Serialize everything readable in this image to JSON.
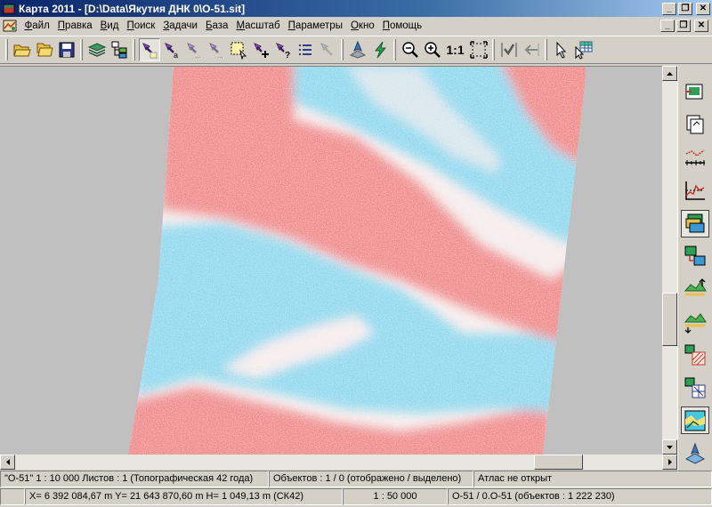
{
  "window": {
    "title": "Карта 2011 - [D:\\Data\\Якутия ДНК 0\\O-51.sit]",
    "controls": [
      "_",
      "❐",
      "✕"
    ]
  },
  "menu": {
    "items": [
      "Файл",
      "Правка",
      "Вид",
      "Поиск",
      "Задачи",
      "База",
      "Масштаб",
      "Параметры",
      "Окно",
      "Помощь"
    ],
    "underlined_letters": [
      "Ф",
      "П",
      "В",
      "П",
      "З",
      "Б",
      "М",
      "П",
      "О",
      "П"
    ]
  },
  "toolbar": {
    "scale_button_label": "1:1",
    "icons": [
      "open-folder-icon",
      "open-set-icon",
      "save-icon",
      "layers-icon",
      "object-tree-icon",
      "select-object-icon",
      "select-text-icon",
      "select-multi-icon",
      "select-area-icon",
      "select-frame-icon",
      "add-object-icon",
      "query-object-icon",
      "list-icon",
      "pointer-dim-icon",
      "compass-icon",
      "lightning-icon",
      "zoom-out-icon",
      "zoom-in-icon",
      "fit-window-icon",
      "check-icon",
      "back-arrow-icon",
      "cursor-icon",
      "table-cursor-icon"
    ]
  },
  "right_panel": {
    "icons": [
      "sheet-create-icon",
      "sheet-copy-icon",
      "ruler-scale-icon",
      "profile-chart-icon",
      "layers-green-icon",
      "raster-transform-icon",
      "relief-up-icon",
      "relief-down-icon",
      "hatch-area-icon",
      "grid-area-icon",
      "map-preview-icon",
      "compass-blue-icon"
    ]
  },
  "status": {
    "map_name": "\"O-51\"  1 : 10 000   Листов : 1   (Топографическая 42 года)",
    "objects": "Объектов : 1 / 0  (отображено / выделено)",
    "atlas": "Атлас не открыт",
    "coordinates": "X= 6 392 084,67 m  Y= 21 643 870,60 m  H= 1 049,13 m  (СК42)",
    "scale": "1 : 50 000",
    "sheet": "O-51 / 0.O-51  (объектов : 1 222 230)"
  },
  "map": {
    "colors": {
      "warm": "#f08a8a",
      "cool": "#8fd8ee",
      "pale": "#f6ecec",
      "background": "#c0c0c0"
    }
  }
}
